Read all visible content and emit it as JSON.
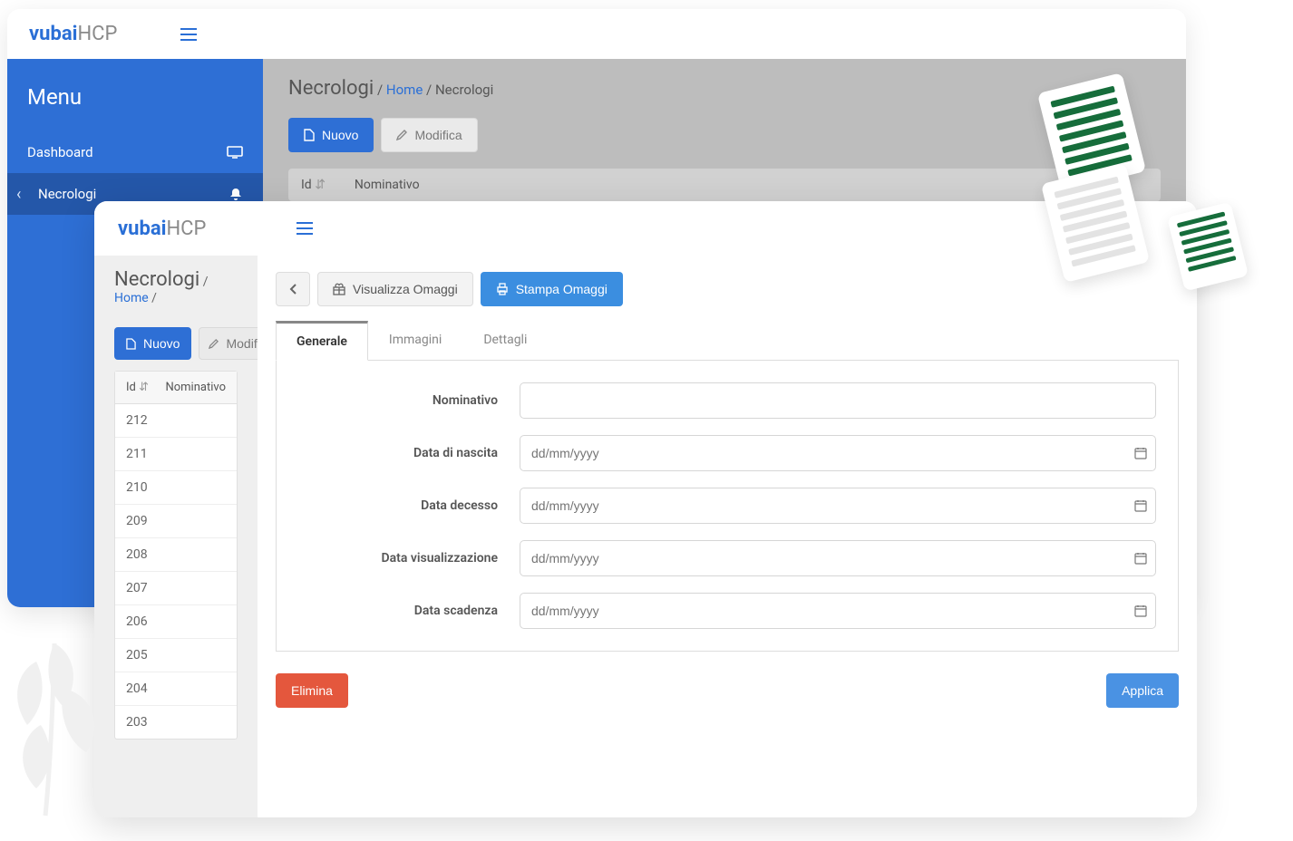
{
  "brand": {
    "prefix": "vubai",
    "suffix": "HCP"
  },
  "sidebar": {
    "title": "Menu",
    "items": [
      {
        "label": "Dashboard"
      },
      {
        "label": "Necrologi"
      }
    ]
  },
  "back": {
    "breadcrumb": {
      "title": "Necrologi",
      "home": "Home",
      "current": "Necrologi"
    },
    "toolbar": {
      "nuovo": "Nuovo",
      "modifica": "Modifica"
    },
    "columns": {
      "id": "Id",
      "nominativo": "Nominativo"
    }
  },
  "front": {
    "breadcrumb": {
      "title": "Necrologi",
      "home": "Home"
    },
    "toolbar": {
      "nuovo": "Nuovo",
      "modifica": "Modific"
    },
    "columns": {
      "id": "Id",
      "nominativo": "Nominativo"
    },
    "rows": [
      "212",
      "211",
      "210",
      "209",
      "208",
      "207",
      "206",
      "205",
      "204",
      "203"
    ],
    "cmdbar": {
      "visualizza": "Visualizza Omaggi",
      "stampa": "Stampa Omaggi"
    },
    "tabs": {
      "generale": "Generale",
      "immagini": "Immagini",
      "dettagli": "Dettagli"
    },
    "form": {
      "nominativo_label": "Nominativo",
      "data_nascita_label": "Data di nascita",
      "data_decesso_label": "Data decesso",
      "data_visual_label": "Data visualizzazione",
      "data_scadenza_label": "Data scadenza",
      "placeholder_date": "dd/mm/yyyy"
    },
    "actions": {
      "elimina": "Elimina",
      "applica": "Applica"
    }
  }
}
